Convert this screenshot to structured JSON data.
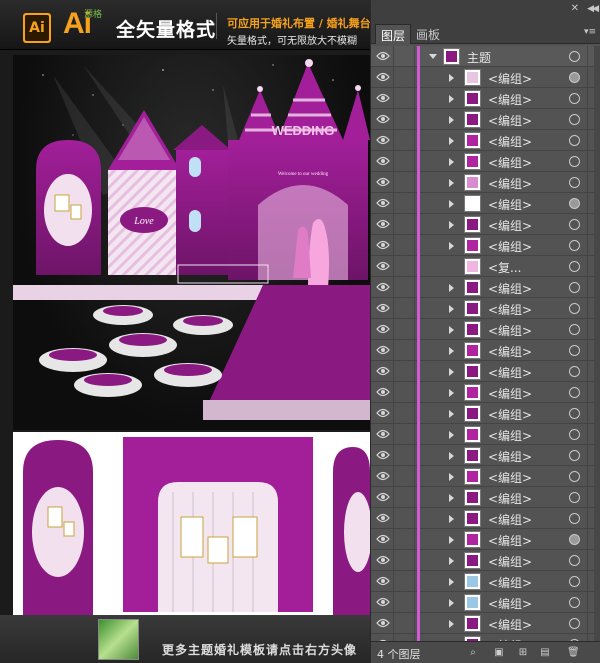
{
  "banner": {
    "ai_badge": "Ai",
    "ai_big": "Ai",
    "ai_small": "源格",
    "title": "全矢量格式",
    "line1": "可应用于婚礼布置 / 婚礼舞台",
    "line2": "矢量格式，可无限放大不模糊"
  },
  "artwork": {
    "wedding_text": "WEDDING",
    "welcome_text": "Welcome to our wedding",
    "love_text": "Love",
    "colors": {
      "purple": "#8a1a82",
      "magenta": "#b0249f",
      "pink": "#e7a9d9"
    }
  },
  "bottom": {
    "text": "更多主题婚礼模板请点击右方头像"
  },
  "panel": {
    "tabs": [
      {
        "label": "图层"
      },
      {
        "label": "画板"
      }
    ],
    "parent_layer": {
      "label": "主题",
      "icon": "theme-thumbnail"
    },
    "layers": [
      {
        "label": "<编组>",
        "target_filled": true,
        "thumb": "#e7c6e2",
        "expand": true
      },
      {
        "label": "<编组>",
        "target_filled": false,
        "thumb": "#8a1a82",
        "expand": true
      },
      {
        "label": "<编组>",
        "target_filled": false,
        "thumb": "#8a1a82",
        "expand": true
      },
      {
        "label": "<编组>",
        "target_filled": false,
        "thumb": "#b0249f",
        "expand": true
      },
      {
        "label": "<编组>",
        "target_filled": false,
        "thumb": "#b0249f",
        "expand": true
      },
      {
        "label": "<编组>",
        "target_filled": false,
        "thumb": "#d78ccf",
        "expand": true
      },
      {
        "label": "<编组>",
        "target_filled": true,
        "thumb": "#ffffff",
        "expand": true
      },
      {
        "label": "<编组>",
        "target_filled": false,
        "thumb": "#8a1a82",
        "expand": true
      },
      {
        "label": "<编组>",
        "target_filled": false,
        "thumb": "#b0249f",
        "expand": true
      },
      {
        "label": "<复...",
        "target_filled": false,
        "thumb": "#f0b6e1",
        "expand": false
      },
      {
        "label": "<编组>",
        "target_filled": false,
        "thumb": "#8a1a82",
        "expand": true
      },
      {
        "label": "<编组>",
        "target_filled": false,
        "thumb": "#8a1a82",
        "expand": true
      },
      {
        "label": "<编组>",
        "target_filled": false,
        "thumb": "#8a1a82",
        "expand": true
      },
      {
        "label": "<编组>",
        "target_filled": false,
        "thumb": "#b0249f",
        "expand": true
      },
      {
        "label": "<编组>",
        "target_filled": false,
        "thumb": "#8a1a82",
        "expand": true
      },
      {
        "label": "<编组>",
        "target_filled": false,
        "thumb": "#b0249f",
        "expand": true
      },
      {
        "label": "<编组>",
        "target_filled": false,
        "thumb": "#8a1a82",
        "expand": true
      },
      {
        "label": "<编组>",
        "target_filled": false,
        "thumb": "#b0249f",
        "expand": true
      },
      {
        "label": "<编组>",
        "target_filled": false,
        "thumb": "#8a1a82",
        "expand": true
      },
      {
        "label": "<编组>",
        "target_filled": false,
        "thumb": "#b0249f",
        "expand": true
      },
      {
        "label": "<编组>",
        "target_filled": false,
        "thumb": "#8a1a82",
        "expand": true
      },
      {
        "label": "<编组>",
        "target_filled": false,
        "thumb": "#8a1a82",
        "expand": true
      },
      {
        "label": "<编组>",
        "target_filled": true,
        "thumb": "#b0249f",
        "expand": true
      },
      {
        "label": "<编组>",
        "target_filled": false,
        "thumb": "#8a1a82",
        "expand": true
      },
      {
        "label": "<编组>",
        "target_filled": false,
        "thumb": "#9ac7e6",
        "expand": true
      },
      {
        "label": "<编组>",
        "target_filled": false,
        "thumb": "#9ac7e6",
        "expand": true
      },
      {
        "label": "<编组>",
        "target_filled": false,
        "thumb": "#8a1a82",
        "expand": true
      },
      {
        "label": "<编组>",
        "target_filled": false,
        "thumb": "#8a1a82",
        "expand": true
      }
    ],
    "footer": {
      "count": "4 个图层"
    }
  }
}
